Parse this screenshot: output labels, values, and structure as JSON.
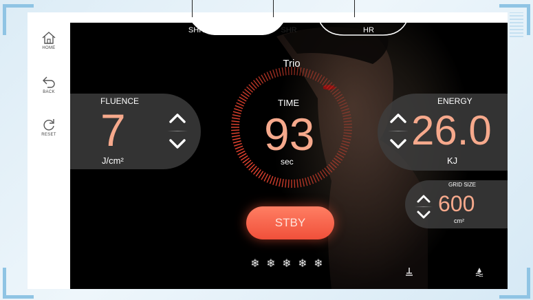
{
  "sidebar": {
    "home_label": "HOME",
    "back_label": "BACK",
    "reset_label": "RESET"
  },
  "tabs": [
    {
      "label": "SHR STACK",
      "active": false
    },
    {
      "label": "SHR",
      "active": true
    },
    {
      "label": "HR",
      "active": false
    }
  ],
  "mode_label": "Trio",
  "fluence": {
    "label": "FLUENCE",
    "value": "7",
    "unit": "J/cm²"
  },
  "time": {
    "label": "TIME",
    "value": "93",
    "unit": "sec"
  },
  "energy": {
    "label": "ENERGY",
    "value": "26.0",
    "unit": "KJ"
  },
  "grid_size": {
    "label": "GRID SIZE",
    "value": "600",
    "unit": "cm²"
  },
  "stby_label": "STBY",
  "cooling_level": {
    "filled": 5,
    "max": 5,
    "icon": "snowflake-icon"
  },
  "colors": {
    "accent": "#f6a98c",
    "button": "#f0503a",
    "frame": "#8fc4e4"
  }
}
